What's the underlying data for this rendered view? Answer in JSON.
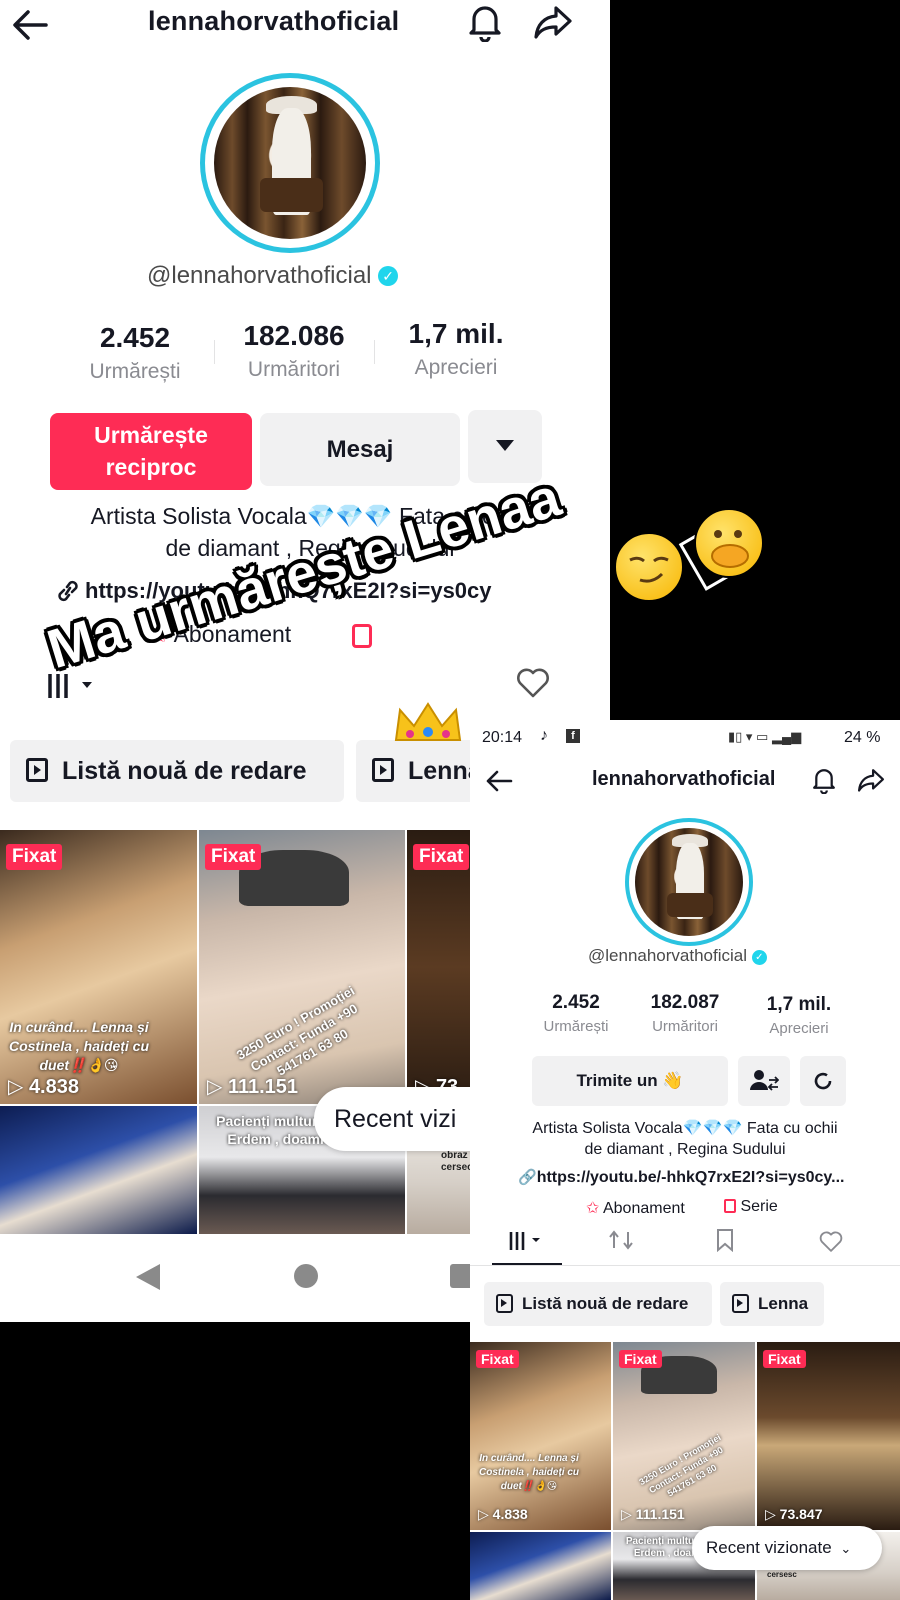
{
  "overlay": {
    "text": "Ma urmărește Lenaa"
  },
  "panel1": {
    "header": {
      "title": "lennahorvathoficial"
    },
    "handle": "@lennahorvathoficial",
    "stats": [
      {
        "value": "2.452",
        "label": "Urmărești"
      },
      {
        "value": "182.086",
        "label": "Urmăritori"
      },
      {
        "value": "1,7 mil.",
        "label": "Aprecieri"
      }
    ],
    "follow_button": {
      "line1": "Urmărește",
      "line2": "reciproc"
    },
    "message_button": "Mesaj",
    "bio_line1": "Artista Solista Vocala💎💎💎 Fata cu ochii",
    "bio_line2": "de diamant , Regina Sudului",
    "link": "https://youtu.be/-hhkQ7rxE2I?si=ys0cy",
    "subscription": "Abonament",
    "playlists": [
      "Listă nouă de redare",
      "Lenna"
    ],
    "videos": [
      {
        "pinned": "Fixat",
        "views": "4.838",
        "caption": "In curând.... Lenna și Costinela , haideți cu duet‼️👌😘"
      },
      {
        "pinned": "Fixat",
        "views": "111.151",
        "caption": "3250 Euro ! Promoției Contact: Funda +90 541761 63 80"
      },
      {
        "pinned": "Fixat",
        "views": "73"
      },
      {
        "caption": ""
      },
      {
        "caption": "Pacienți multum la Erdem , doamn"
      },
      {
        "caption": "obraz cersec"
      }
    ],
    "recent": "Recent vizi"
  },
  "panel2": {
    "status": {
      "time": "20:14",
      "battery": "24 %"
    },
    "header": {
      "title": "lennahorvathoficial"
    },
    "handle": "@lennahorvathoficial",
    "stats": [
      {
        "value": "2.452",
        "label": "Urmărești"
      },
      {
        "value": "182.087",
        "label": "Urmăritori"
      },
      {
        "value": "1,7 mil.",
        "label": "Aprecieri"
      }
    ],
    "send_button": "Trimite un 👋",
    "bio_line1": "Artista Solista Vocala💎💎💎 Fata cu ochii",
    "bio_line2": "de diamant , Regina Sudului",
    "link": "https://youtu.be/-hhkQ7rxE2I?si=ys0cy...",
    "subscription": "Abonament",
    "series": "Serie",
    "playlists": [
      "Listă nouă de redare",
      "Lenna"
    ],
    "videos": [
      {
        "pinned": "Fixat",
        "views": "4.838",
        "caption": "In curând.... Lenna și Costinela , haideți cu duet‼️👌😘"
      },
      {
        "pinned": "Fixat",
        "views": "111.151",
        "caption": "3250 Euro ! Promoției Contact: Funda +90 541761 63 80"
      },
      {
        "pinned": "Fixat",
        "views": "73.847"
      },
      {
        "caption": ""
      },
      {
        "caption": "Pacienți multum la Erdem , doamn"
      },
      {
        "caption": "obrazul de rusine sa cersesc"
      }
    ],
    "recent": "Recent vizionate"
  },
  "colors": {
    "accent": "#fe2c55",
    "avatar_ring": "#2bc3e0",
    "verified": "#20d5ec"
  }
}
